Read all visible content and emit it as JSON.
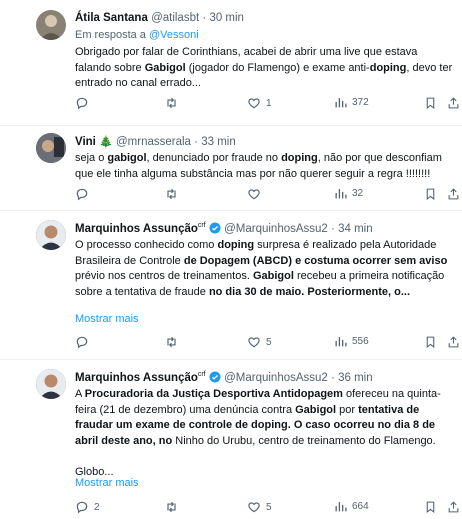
{
  "tweets": [
    {
      "author": "Átila Santana",
      "handle": "@atilasbt",
      "time": "30 min",
      "reply_prefix": "Em resposta a ",
      "reply_to": "@Vessoni",
      "text": [
        {
          "t": "Obrigado por falar de Corinthians, acabei de abrir uma live que estava falando sobre "
        },
        {
          "t": "Gabigol",
          "b": true
        },
        {
          "t": " (jogador do Flamengo) e exame anti-"
        },
        {
          "t": "doping",
          "b": true
        },
        {
          "t": ", devo ter entrado no canal errado..."
        }
      ],
      "replies": "",
      "retweets": "",
      "likes": "1",
      "views": "372",
      "avatar_color": "#7d7468"
    },
    {
      "author": "Vini",
      "author_emoji": "🎄",
      "handle": "@mrnasserala",
      "time": "33 min",
      "text": [
        {
          "t": "seja o "
        },
        {
          "t": "gabigol",
          "b": true
        },
        {
          "t": ", denunciado por fraude no "
        },
        {
          "t": "doping",
          "b": true
        },
        {
          "t": ", não por que desconfiam que ele tinha alguma substância mas por não querer seguir a regra !!!!!!!!"
        }
      ],
      "replies": "",
      "retweets": "",
      "likes": "",
      "views": "32",
      "avatar_color": "#4a4f57"
    },
    {
      "author": "Marquinhos Assunção",
      "author_tag": "crf",
      "handle": "@MarquinhosAssu2",
      "time": "34 min",
      "text": [
        {
          "t": "O processo conhecido como "
        },
        {
          "t": "doping",
          "b": true
        },
        {
          "t": " surpresa é realizado pela Autoridade Brasileira de Controle "
        },
        {
          "t": "de Dopagem (ABCD) e costuma ocorrer sem aviso",
          "b": true
        },
        {
          "t": " prévio nos centros de treinamentos. "
        },
        {
          "t": "Gabigol",
          "b": true
        },
        {
          "t": " recebeu a primeira notificação sobre a tentativa de fraude "
        },
        {
          "t": "no dia 30 de maio.",
          "b": true
        },
        {
          "t": " "
        },
        {
          "t": "Posteriormente, o...",
          "b": true
        }
      ],
      "show_more": "Mostrar mais",
      "replies": "",
      "retweets": "",
      "likes": "5",
      "views": "556",
      "avatar_color": "#3b4a5a"
    },
    {
      "author": "Marquinhos Assunção",
      "author_tag": "crf",
      "handle": "@MarquinhosAssu2",
      "time": "36 min",
      "text": [
        {
          "t": "A "
        },
        {
          "t": "Procuradoria da Justiça Desportiva Antidopagem",
          "b": true
        },
        {
          "t": " ofereceu na quinta-feira (21 de dezembro) uma denúncia contra "
        },
        {
          "t": "Gabigol",
          "b": true
        },
        {
          "t": " por "
        },
        {
          "t": "tentativa de fraudar um exame de controle de doping. O caso ocorreu no dia 8 de abril deste ano, no",
          "b": true
        },
        {
          "t": " Ninho do Urubu, centro de treinamento do Flamengo."
        },
        {
          "t": "\n\nGlobo..."
        }
      ],
      "show_more": "Mostrar mais",
      "replies": "2",
      "retweets": "",
      "likes": "5",
      "views": "664",
      "avatar_color": "#3b4a5a"
    }
  ]
}
